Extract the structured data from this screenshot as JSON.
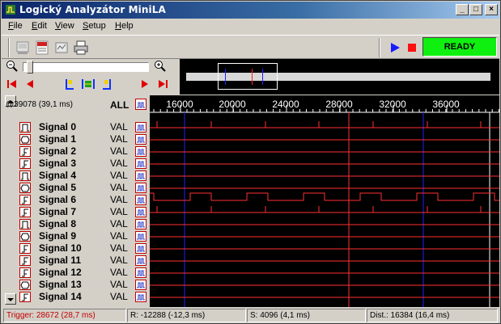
{
  "window": {
    "title": "Logický Analyzátor MiniLA",
    "minimize": "_",
    "maximize": "□",
    "close": "×"
  },
  "menu": [
    {
      "label": "File"
    },
    {
      "label": "Edit"
    },
    {
      "label": "View"
    },
    {
      "label": "Setup"
    },
    {
      "label": "Help"
    }
  ],
  "toolbar": {
    "status": "READY"
  },
  "left": {
    "position": "@39078 (39,1 ms)",
    "all_label": "ALL"
  },
  "timeline": {
    "ticks": [
      "16000",
      "20000",
      "24000",
      "28000",
      "32000",
      "36000"
    ]
  },
  "signals": [
    {
      "name": "Signal 0",
      "val": "VAL",
      "icon": "clock-icon"
    },
    {
      "name": "Signal 1",
      "val": "VAL",
      "icon": "bus-icon"
    },
    {
      "name": "Signal 2",
      "val": "VAL",
      "icon": "edge-icon"
    },
    {
      "name": "Signal 3",
      "val": "VAL",
      "icon": "edge-icon"
    },
    {
      "name": "Signal 4",
      "val": "VAL",
      "icon": "clock-icon"
    },
    {
      "name": "Signal 5",
      "val": "VAL",
      "icon": "bus-icon"
    },
    {
      "name": "Signal 6",
      "val": "VAL",
      "icon": "edge-icon"
    },
    {
      "name": "Signal 7",
      "val": "VAL",
      "icon": "edge-icon"
    },
    {
      "name": "Signal 8",
      "val": "VAL",
      "icon": "clock-icon"
    },
    {
      "name": "Signal 9",
      "val": "VAL",
      "icon": "bus-icon"
    },
    {
      "name": "Signal 10",
      "val": "VAL",
      "icon": "edge-icon"
    },
    {
      "name": "Signal 11",
      "val": "VAL",
      "icon": "edge-icon"
    },
    {
      "name": "Signal 12",
      "val": "VAL",
      "icon": "edge-icon"
    },
    {
      "name": "Signal 13",
      "val": "VAL",
      "icon": "bus-icon"
    },
    {
      "name": "Signal 14",
      "val": "VAL",
      "icon": "edge-icon"
    }
  ],
  "status": {
    "trigger": "Trigger: 28672 (28,7 ms)",
    "r": "R: -12288 (-12,3 ms)",
    "s": "S: 4096 (4,1 ms)",
    "dist": "Dist.: 16384 (16,4 ms)"
  },
  "colors": {
    "trace": "#ff3030",
    "cursor_blue": "#2020ff",
    "ready": "#10f010",
    "icon_border": "#c00000"
  }
}
